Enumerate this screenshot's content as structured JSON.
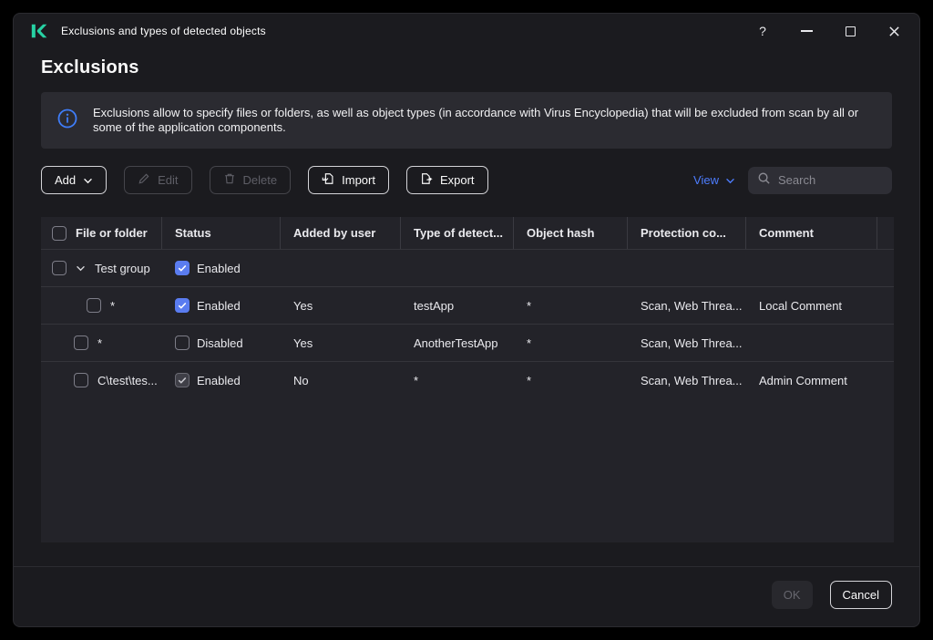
{
  "window": {
    "title": "Exclusions and types of detected objects",
    "help_glyph": "?"
  },
  "page": {
    "title": "Exclusions"
  },
  "banner": {
    "text": "Exclusions allow to specify files or folders, as well as object types (in accordance with Virus Encyclopedia) that will be excluded from scan by all or some of the application components."
  },
  "toolbar": {
    "add_label": "Add",
    "edit_label": "Edit",
    "delete_label": "Delete",
    "import_label": "Import",
    "export_label": "Export",
    "view_label": "View",
    "search_placeholder": "Search"
  },
  "table": {
    "headers": {
      "file": "File or folder",
      "status": "Status",
      "added": "Added by user",
      "type": "Type of detect...",
      "hash": "Object hash",
      "protection": "Protection co...",
      "comment": "Comment"
    },
    "rows": [
      {
        "file": "Test group",
        "status": "Enabled",
        "added": "",
        "type": "",
        "hash": "",
        "protection": "",
        "comment": ""
      },
      {
        "file": "*",
        "status": "Enabled",
        "added": "Yes",
        "type": "testApp",
        "hash": "*",
        "protection": "Scan, Web Threa...",
        "comment": "Local Comment"
      },
      {
        "file": "*",
        "status": "Disabled",
        "added": "Yes",
        "type": "AnotherTestApp",
        "hash": "*",
        "protection": "Scan, Web Threa...",
        "comment": ""
      },
      {
        "file": "C\\test\\tes...",
        "status": "Enabled",
        "added": "No",
        "type": "*",
        "hash": "*",
        "protection": "Scan, Web Threa...",
        "comment": "Admin Comment"
      }
    ]
  },
  "footer": {
    "ok_label": "OK",
    "cancel_label": "Cancel"
  },
  "colors": {
    "accent_blue": "#4d7dff",
    "checkbox_blue": "#5a7cf0",
    "brand_teal": "#27d2a4",
    "window_bg": "#1b1b1f",
    "panel_bg": "#2b2b31",
    "table_bg": "#232329",
    "info_icon": "#3f7df8"
  }
}
